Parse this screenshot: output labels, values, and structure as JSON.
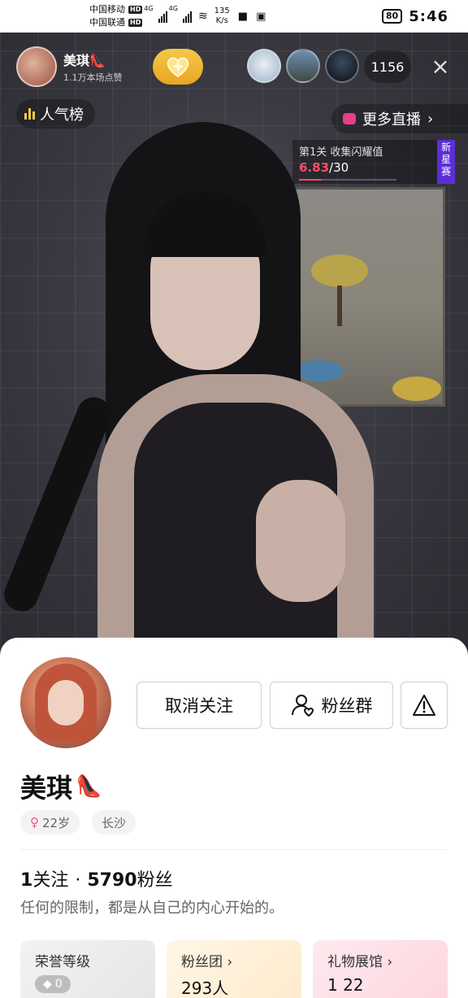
{
  "status_bar": {
    "carrier_1": "中国移动",
    "carrier_2": "中国联通",
    "hd": "HD",
    "net_1": "4G",
    "net_2": "4G",
    "speed_value": "135",
    "speed_unit": "K/s",
    "battery": "80",
    "time": "5:46"
  },
  "live": {
    "host_name": "美琪👠",
    "host_likes": "1.1万本场点赞",
    "viewer_count": "1156",
    "rank_label": "人气榜",
    "more_live_label": "更多直播",
    "task": {
      "title": "第1关 收集闪耀值",
      "current": "6.83",
      "target": "/30",
      "progress_fraction": 0.23,
      "badge": "新星赛"
    }
  },
  "profile": {
    "unfollow_label": "取消关注",
    "fan_group_label": "粉丝群",
    "name": "美琪",
    "name_emoji": "👠",
    "age_tag": "22岁",
    "city_tag": "长沙",
    "following_count": "1",
    "following_label": "关注",
    "separator": "·",
    "followers_count": "5790",
    "followers_label": "粉丝",
    "bio": "任何的限制，都是从自己的内心开始的。",
    "cards": {
      "honor_label": "荣誉等级",
      "honor_value": "0",
      "fans_label": "粉丝团",
      "fans_value": "293人",
      "gifts_label": "礼物展馆",
      "gifts_value": "1 22"
    }
  },
  "colors": {
    "accent_pink": "#ff4d6a",
    "gold": "#f4c84a",
    "badge_purple": "#5b2fd6"
  }
}
